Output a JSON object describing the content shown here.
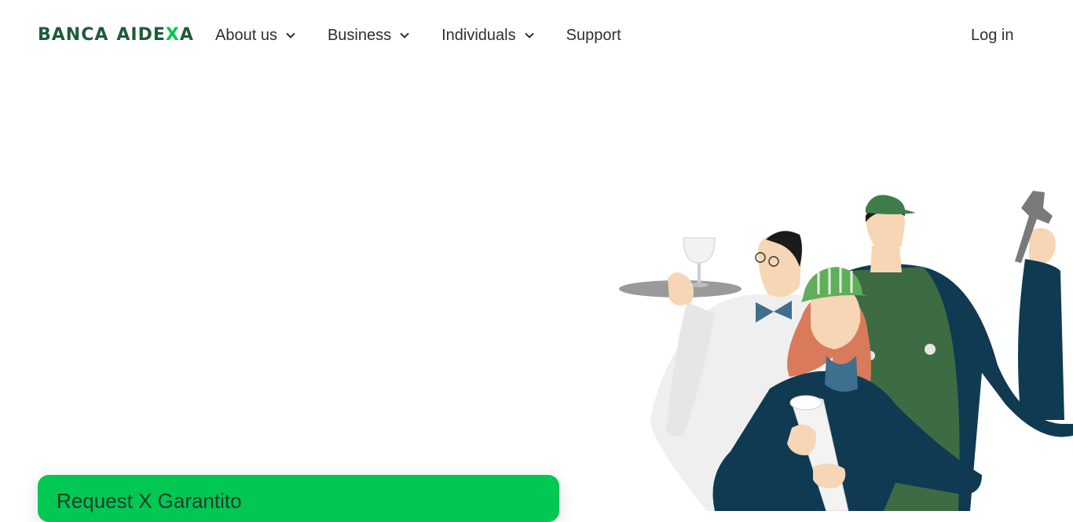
{
  "brand": {
    "logo_part1": "BANCA",
    "logo_part2a": "AIDE",
    "logo_part2b": "X",
    "logo_part2c": "A",
    "color_primary": "#1e5b3a",
    "color_accent": "#00c853"
  },
  "nav": {
    "items": [
      {
        "label": "About us",
        "has_dropdown": true
      },
      {
        "label": "Business",
        "has_dropdown": true
      },
      {
        "label": "Individuals",
        "has_dropdown": true
      },
      {
        "label": "Support",
        "has_dropdown": false
      }
    ],
    "login_label": "Log in"
  },
  "cta": {
    "label": "Request X Garantito"
  },
  "hero": {
    "illustration_icon": "workers-illustration"
  }
}
